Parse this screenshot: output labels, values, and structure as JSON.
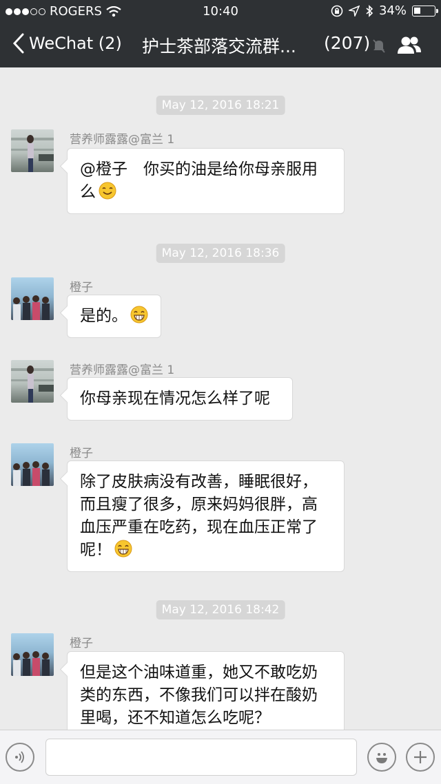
{
  "status_bar": {
    "carrier": "ROGERS",
    "time": "10:40",
    "battery": "34%",
    "battery_level": 0.34
  },
  "nav": {
    "back_label": "WeChat (2)",
    "title": "护士茶部落交流群...",
    "member_count": "(207)"
  },
  "messages": [
    {
      "type": "time",
      "text": "May 12, 2016 18:21"
    },
    {
      "type": "msg",
      "sender": "营养师露露@富兰 1",
      "text": "@橙子　你买的油是给你母亲服用么",
      "emoji": "smile-emoji"
    },
    {
      "type": "time",
      "text": "May 12, 2016 18:36"
    },
    {
      "type": "msg",
      "sender": "橙子",
      "text": "是的。",
      "emoji": "grin-emoji"
    },
    {
      "type": "msg",
      "sender": "营养师露露@富兰 1",
      "text": "你母亲现在情况怎么样了呢"
    },
    {
      "type": "msg",
      "sender": "橙子",
      "text": "除了皮肤病没有改善，睡眠很好，而且瘦了很多，原来妈妈很胖，高血压严重在吃药，现在血压正常了呢！",
      "emoji": "grin-emoji"
    },
    {
      "type": "time",
      "text": "May 12, 2016 18:42"
    },
    {
      "type": "msg",
      "sender": "橙子",
      "text": "但是这个油味道重，她又不敢吃奶类的东西，不像我们可以拌在酸奶里喝，还不知道怎么吃呢？"
    }
  ],
  "input": {
    "value": "",
    "voice_icon": "voice-icon",
    "emoji_icon": "emoji-face-icon",
    "more_icon": "plus-icon"
  }
}
